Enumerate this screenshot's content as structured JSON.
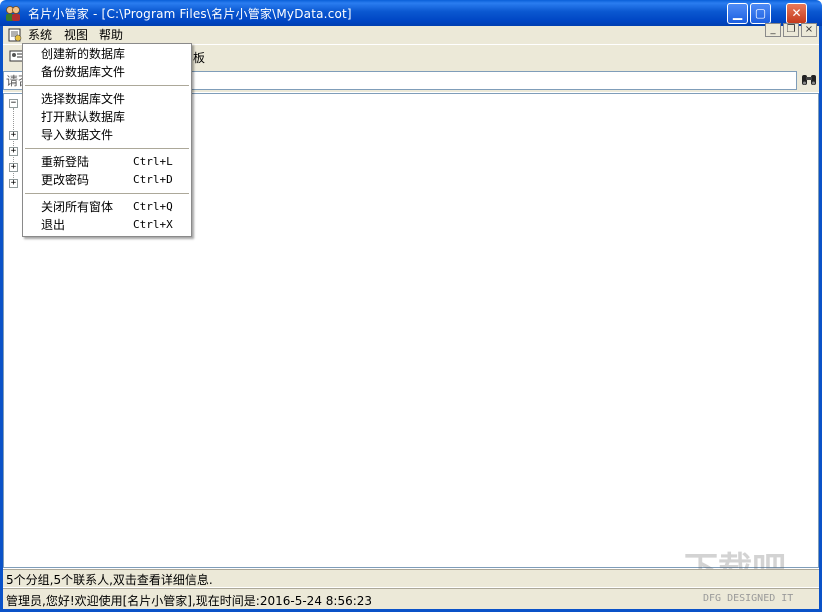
{
  "window": {
    "title": "名片小管家 - [C:\\Program Files\\名片小管家\\MyData.cot]",
    "icons": {
      "app": "people-icon",
      "minimize": "minimize-icon",
      "maximize": "maximize-icon",
      "close": "close-icon"
    },
    "symbols": {
      "minimize": "▁",
      "maximize": "▢",
      "close": "✕"
    }
  },
  "menubar": {
    "items": [
      {
        "label": "系统"
      },
      {
        "label": "视图"
      },
      {
        "label": "帮助"
      }
    ],
    "mdi_buttons": {
      "minimize": "_",
      "restore": "❐",
      "close": "×"
    }
  },
  "toolbar": {
    "partial_label": "板"
  },
  "search": {
    "visible_text": "请否"
  },
  "tree": {
    "root_expander": "−",
    "child_expanders": [
      "+",
      "+",
      "+",
      "+"
    ]
  },
  "system_menu": {
    "groups": [
      [
        {
          "label": "创建新的数据库",
          "shortcut": ""
        },
        {
          "label": "备份数据库文件",
          "shortcut": ""
        }
      ],
      [
        {
          "label": "选择数据库文件",
          "shortcut": ""
        },
        {
          "label": "打开默认数据库",
          "shortcut": ""
        },
        {
          "label": "导入数据文件",
          "shortcut": ""
        }
      ],
      [
        {
          "label": "重新登陆",
          "shortcut": "Ctrl+L"
        },
        {
          "label": "更改密码",
          "shortcut": "Ctrl+D"
        }
      ],
      [
        {
          "label": "关闭所有窗体",
          "shortcut": "Ctrl+Q"
        },
        {
          "label": "退出",
          "shortcut": "Ctrl+X"
        }
      ]
    ]
  },
  "status": {
    "line1": "5个分组,5个联系人,双击查看详细信息.",
    "line2": "管理员,您好!欢迎使用[名片小管家],现在时间是:2016-5-24 8:56:23",
    "credit": "DFG DESIGNED IT"
  },
  "colors": {
    "titlebar": "#0a57d0",
    "chrome": "#ece9d8",
    "border": "#7f9db9"
  }
}
